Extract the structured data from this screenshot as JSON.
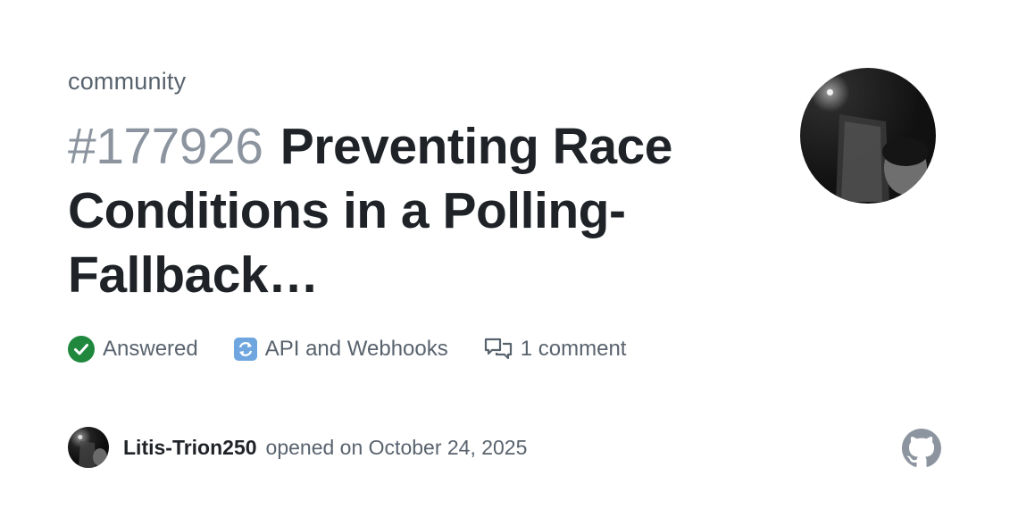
{
  "repo": {
    "name": "community"
  },
  "issue": {
    "number": "#177926",
    "title": "Preventing Race Conditions in a Polling-Fallback…"
  },
  "meta": {
    "status_label": "Answered",
    "category_label": "API and Webhooks",
    "comments_label": "1 comment"
  },
  "footer": {
    "author": "Litis-Trion250",
    "opened_text": "opened on October 24, 2025"
  },
  "icons": {
    "status": "check-circle-icon",
    "category": "arrows-refresh-icon",
    "comments": "comment-discussion-icon",
    "brand": "github-logo-icon"
  },
  "colors": {
    "answered_green": "#1f883d",
    "text_primary": "#1f2328",
    "text_muted": "#59636e",
    "number_gray": "#8c959f",
    "category_blue": "#6fa6e0",
    "logo_gray": "#8c959f"
  }
}
